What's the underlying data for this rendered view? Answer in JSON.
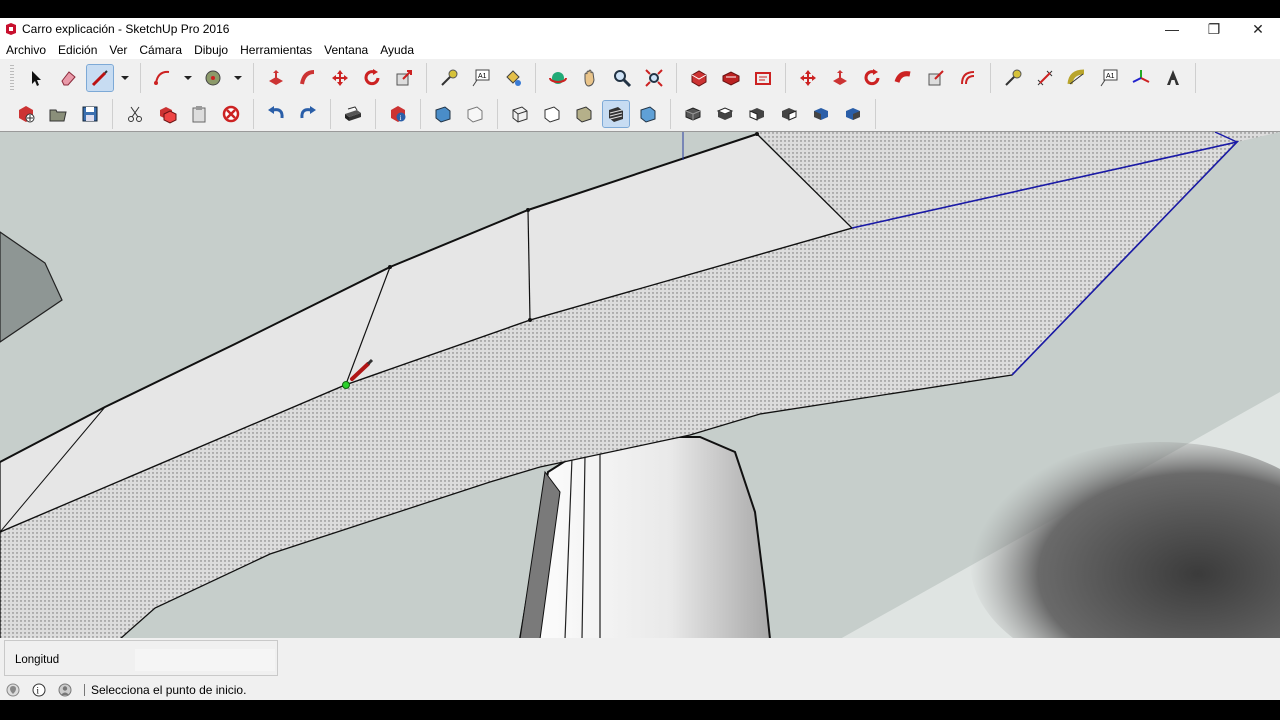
{
  "window": {
    "title": "Carro explicación - SketchUp Pro 2016",
    "minimize": "—",
    "restore": "❐",
    "close": "✕"
  },
  "menu": [
    "Archivo",
    "Edición",
    "Ver",
    "Cámara",
    "Dibujo",
    "Herramientas",
    "Ventana",
    "Ayuda"
  ],
  "toolbar1": {
    "tools": [
      "select",
      "eraser",
      "line",
      "arc",
      "shapes",
      "push-pull",
      "follow-me",
      "move",
      "rotate",
      "scale",
      "tape-measure",
      "text",
      "paint-bucket",
      "orbit",
      "pan",
      "zoom",
      "zoom-extents",
      "warehouse",
      "extension-warehouse",
      "layout",
      "move-2",
      "push-pull-2",
      "rotate-2",
      "follow-me-2",
      "scale-2",
      "offset",
      "tape-2",
      "dimension",
      "protractor",
      "text-2",
      "axes",
      "3d-text"
    ]
  },
  "toolbar2": {
    "tools": [
      "new",
      "open",
      "save",
      "cut",
      "copy",
      "paste",
      "delete",
      "undo",
      "redo",
      "print",
      "model-info",
      "xray",
      "back-edges",
      "wireframe",
      "hidden-line",
      "shaded",
      "shaded-textures",
      "monochrome",
      "iso",
      "top",
      "front",
      "right",
      "back",
      "left"
    ]
  },
  "status": {
    "measure_label": "Longitud",
    "measure_value": "",
    "hint": "Selecciona el punto de inicio."
  },
  "colors": {
    "viewport_bg": "#c6cecb",
    "face": "#e8e8e8",
    "selected_edge": "#1a1aa8",
    "accent_active": "#c7dcf2"
  }
}
